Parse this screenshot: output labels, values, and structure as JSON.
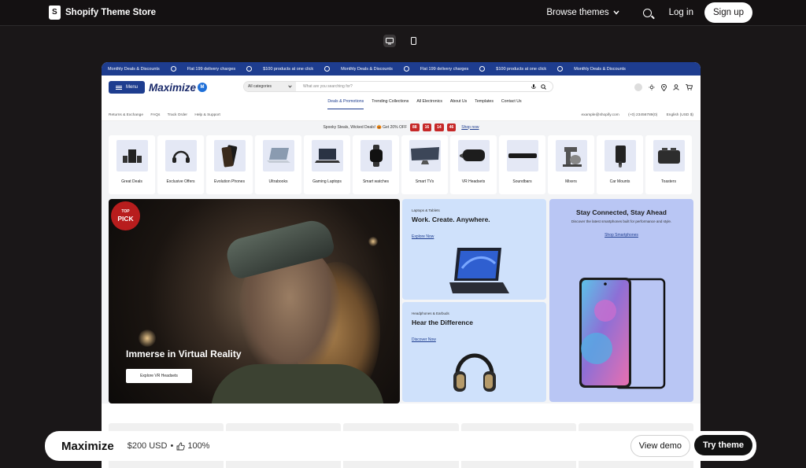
{
  "topbar": {
    "brand": "Shopify Theme Store",
    "browse_label": "Browse themes",
    "login_label": "Log in",
    "signup_label": "Sign up"
  },
  "ticker": [
    "Monthly Deals & Discounts",
    "Flat 199 delivery charges",
    "$100 products at one click",
    "Monthly Deals & Discounts",
    "Flat 199 delivery charges",
    "$100 products at one click",
    "Monthly Deals & Discounts"
  ],
  "store_header": {
    "menu_label": "Menu",
    "logo": "Maximize",
    "logo_badge": "M",
    "category_select": "All categories",
    "search_placeholder": "What are you searching for?"
  },
  "category_nav": [
    "Deals & Promotions",
    "Trending Collections",
    "All Electronics",
    "About Us",
    "Templates",
    "Contact Us"
  ],
  "util_left": [
    "Returns & Exchange",
    "FAQs",
    "Track Order",
    "Help & Support"
  ],
  "util_right": [
    "example@shopify.com",
    "(+0) 23456789(0)",
    "English (USD $)"
  ],
  "promo": {
    "text": "Spooky Steals, Wicked Deals! 🎃 Get 20% OFF",
    "countdown": [
      "88",
      "16",
      "14",
      "46"
    ],
    "link": "Shop now"
  },
  "categories": [
    "Great Deals",
    "Exclusive Offers",
    "Evolution Phones",
    "Ultrabooks",
    "Gaming Laptops",
    "Smart watches",
    "Smart TVs",
    "VR Headsets",
    "Soundbars",
    "Mixers",
    "Car Mounts",
    "Toasters"
  ],
  "hero": {
    "badge_top": "TOP",
    "badge_bottom": "PICK",
    "title": "Immerse in Virtual Reality",
    "button": "Explore VR Headsets"
  },
  "banner_laptops": {
    "kicker": "Laptops & Tablets",
    "title": "Work. Create. Anywhere.",
    "link": "Explore Now"
  },
  "banner_headphones": {
    "kicker": "Headphones & Earbuds",
    "title": "Hear the Difference",
    "link": "Discover Now"
  },
  "banner_phones": {
    "title": "Stay Connected, Stay Ahead",
    "subtitle": "Discover the latest smartphones built for performance and style.",
    "link": "Shop Smartphones"
  },
  "bottom_bar": {
    "theme_name": "Maximize",
    "price": "$200 USD",
    "rating": "100%",
    "demo_label": "View demo",
    "try_label": "Try theme"
  },
  "colors": {
    "ticker_bg": "#1e3d8f",
    "accent": "#1e3d8f",
    "badge_red": "#b81d1d"
  }
}
